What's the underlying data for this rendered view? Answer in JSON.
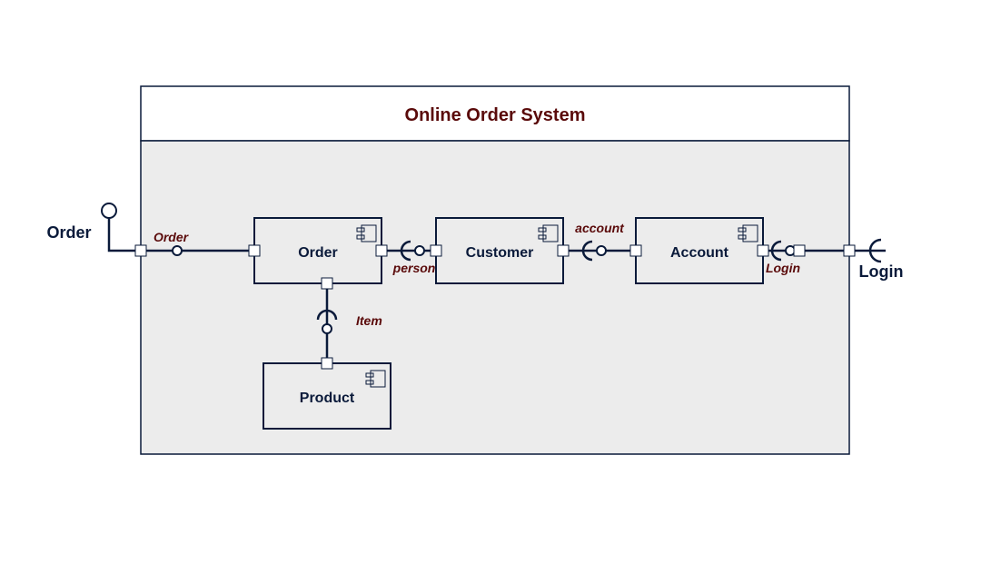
{
  "system": {
    "title": "Online Order System"
  },
  "components": {
    "order": {
      "label": "Order"
    },
    "customer": {
      "label": "Customer"
    },
    "account": {
      "label": "Account"
    },
    "product": {
      "label": "Product"
    }
  },
  "interfaces": {
    "order": {
      "label": "Order"
    },
    "person": {
      "label": "person"
    },
    "item": {
      "label": "Item"
    },
    "account": {
      "label": "account"
    },
    "login": {
      "label": "Login"
    }
  },
  "externals": {
    "order_left": {
      "label": "Order"
    },
    "login_right": {
      "label": "Login"
    }
  }
}
